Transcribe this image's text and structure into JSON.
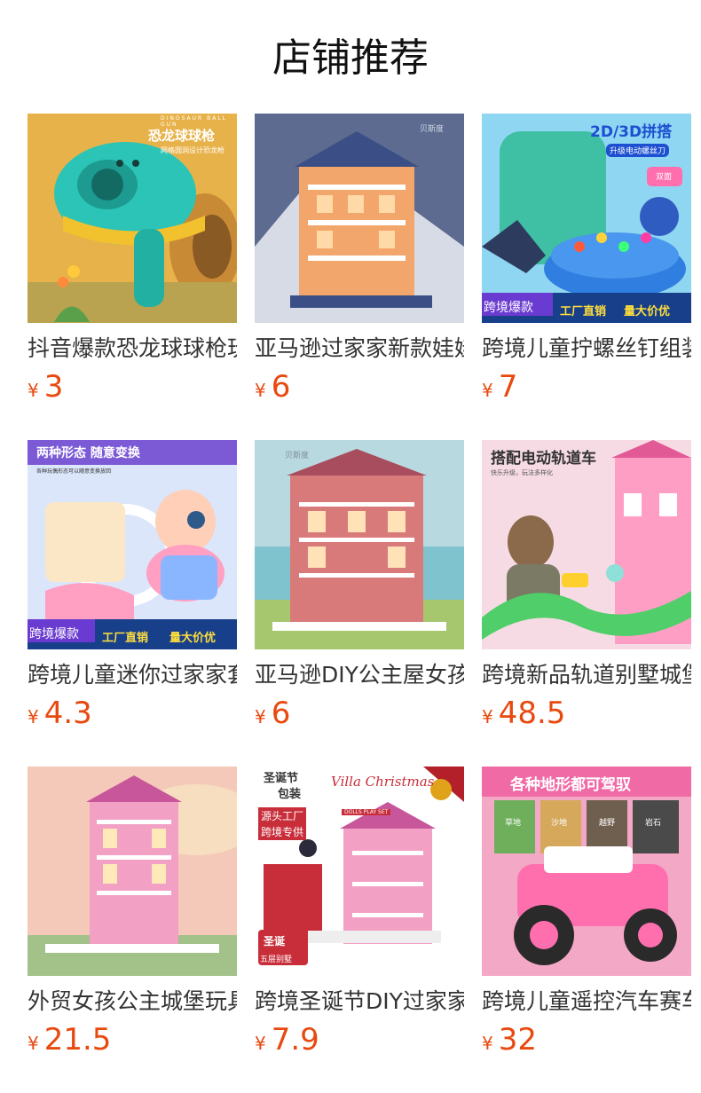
{
  "page": {
    "title": "店铺推荐"
  },
  "accent_color": "#e8490f",
  "products": [
    {
      "name": "抖音爆款恐龙球球枪玩具",
      "currency": "¥",
      "price": "3",
      "image_text": [
        "恐龙球球枪",
        "网格圆洞设计恐龙枪",
        "DINOSAUR BALL GUN"
      ]
    },
    {
      "name": "亚马逊过家家新款娃娃屋",
      "currency": "¥",
      "price": "6",
      "image_text": [
        "贝斯度"
      ]
    },
    {
      "name": "跨境儿童拧螺丝钉组装玩具",
      "currency": "¥",
      "price": "7",
      "image_text": [
        "2D/3D拼搭",
        "升级电动螺丝刀",
        "双面",
        "跨境爆款",
        "工厂直销",
        "量大价优"
      ]
    },
    {
      "name": "跨境儿童迷你过家家套装",
      "currency": "¥",
      "price": "4.3",
      "image_text": [
        "两种形态 随意变换",
        "各种玩偶形态可以随意变换放回",
        "跨境爆款",
        "工厂直销",
        "量大价优"
      ]
    },
    {
      "name": "亚马逊DIY公主屋女孩玩具",
      "currency": "¥",
      "price": "6",
      "image_text": [
        "贝斯度"
      ]
    },
    {
      "name": "跨境新品轨道别墅城堡玩具",
      "currency": "¥",
      "price": "48.5",
      "image_text": [
        "搭配电动轨道车",
        "快乐升级，玩法多样化"
      ]
    },
    {
      "name": "外贸女孩公主城堡玩具",
      "currency": "¥",
      "price": "21.5",
      "image_text": []
    },
    {
      "name": "跨境圣诞节DIY过家家玩具",
      "currency": "¥",
      "price": "7.9",
      "image_text": [
        "圣诞节",
        "包装",
        "源头工厂",
        "跨境专供",
        "Villa Christmas",
        "DOLLS PLAY SET",
        "圣诞",
        "五层别墅"
      ]
    },
    {
      "name": "跨境儿童遥控汽车赛车",
      "currency": "¥",
      "price": "32",
      "image_text": [
        "各种地形都可驾驭",
        "草地",
        "沙地",
        "越野",
        "岩石"
      ]
    }
  ]
}
